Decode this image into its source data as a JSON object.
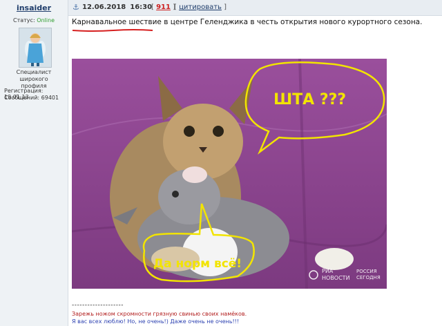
{
  "user": {
    "name": "insaider",
    "status_label": "Статус:",
    "status_value": "Online",
    "title_line1": "Специалист широкого",
    "title_line2": "профиля",
    "registration": "Регистрация: 19.01.13",
    "posts": "Сообщений: 69401",
    "status_color": "#2e9d2e"
  },
  "post": {
    "date": "12.06.2018",
    "time": "16:30",
    "bracket_open": "[",
    "number": "911",
    "bracket_close": "]",
    "quote_open": "[",
    "quote_label": "цитировать",
    "quote_close": "]",
    "text": "Карнавальное шествие в центре Геленджика в честь открытия нового курортного сезона.",
    "number_color": "#cc1f1f"
  },
  "image": {
    "bubble_top": "ШТА ???",
    "bubble_bottom": "Да норм всё!",
    "watermark_line1": "РИА",
    "watermark_line2": "НОВОСТИ",
    "watermark_line3": "РОССИЯ",
    "watermark_line4": "СЕГОДНЯ",
    "bubble_color": "#f2e400"
  },
  "signature": {
    "divider": "--------------------",
    "line1": "Зарежь ножом скромности грязную свинью своих намёков.",
    "line2": "Я вас всех люблю! Но, не очень!) Даже очень не очень!!!",
    "line1_color": "#b11c1c",
    "line2_color": "#2a3fb0"
  },
  "icons": {
    "anchor": "⚓",
    "post_anchor_icon": "anchor-icon"
  }
}
